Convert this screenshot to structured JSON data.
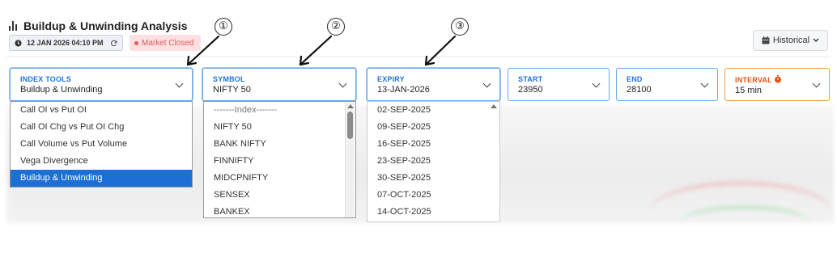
{
  "header": {
    "title": "Buildup & Unwinding Analysis",
    "datetime": "12 JAN 2026 04:10 PM",
    "market_status": "Market Closed",
    "historical_label": "Historical"
  },
  "fields": {
    "index_tools": {
      "label": "INDEX TOOLS",
      "value": "Buildup & Unwinding"
    },
    "symbol": {
      "label": "SYMBOL",
      "value": "NIFTY 50"
    },
    "expiry": {
      "label": "EXPIRY",
      "value": "13-JAN-2026"
    },
    "start": {
      "label": "START",
      "value": "23950"
    },
    "end": {
      "label": "END",
      "value": "28100"
    },
    "interval": {
      "label": "INTERVAL",
      "value": "15 min"
    }
  },
  "index_tools_options": [
    "Call OI vs Put OI",
    "Call OI Chg vs Put OI Chg",
    "Call Volume vs Put Volume",
    "Vega Divergence",
    "Buildup & Unwinding"
  ],
  "symbol_options": [
    "-------Index-------",
    "NIFTY 50",
    "BANK NIFTY",
    "FINNIFTY",
    "MIDCPNIFTY",
    "SENSEX",
    "BANKEX"
  ],
  "expiry_options": [
    "02-SEP-2025",
    "09-SEP-2025",
    "16-SEP-2025",
    "23-SEP-2025",
    "30-SEP-2025",
    "07-OCT-2025",
    "14-OCT-2025"
  ],
  "annotations": [
    "①",
    "②",
    "③"
  ],
  "colors": {
    "accent": "#1e73d8",
    "selected": "#1c6fd4",
    "market_closed": "#e05a5a",
    "interval_accent": "#e25418"
  }
}
